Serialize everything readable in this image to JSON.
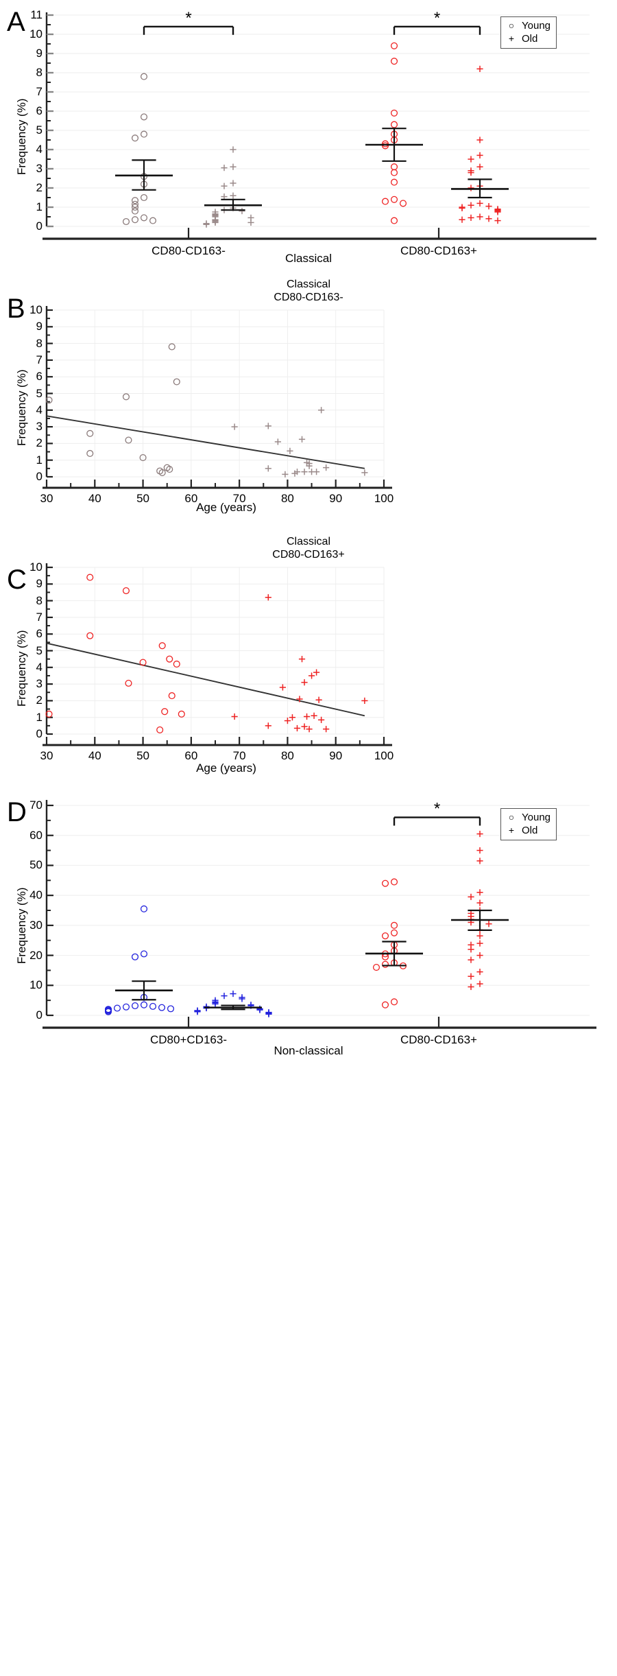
{
  "figure": {
    "panels": [
      "A",
      "B",
      "C",
      "D"
    ]
  },
  "legend": {
    "young_symbol": "○",
    "young_label": "Young",
    "old_symbol": "+",
    "old_label": "Old"
  },
  "significance_marker": "*",
  "colors": {
    "young_gray": "#8a7a7a",
    "old_gray": "#9a8a8a",
    "red": "#ee2222",
    "blue": "#2222dd",
    "axis": "#222222",
    "grid": "#eeeeee",
    "fit_line": "#333333"
  },
  "panelA": {
    "letter": "A",
    "ylabel": "Frequency (%)",
    "xlabel": "Classical",
    "ylim": [
      0,
      11
    ],
    "yticks": [
      0,
      1,
      2,
      3,
      4,
      5,
      6,
      7,
      8,
      9,
      10,
      11
    ],
    "groups": [
      "CD80-CD163-",
      "CD80-CD163+"
    ],
    "chart_data": {
      "type": "scatter",
      "title": "",
      "xlabel": "Classical",
      "ylabel": "Frequency (%)",
      "ylim": [
        0,
        11
      ],
      "yticks": [
        0,
        1,
        2,
        3,
        4,
        5,
        6,
        7,
        8,
        9,
        10,
        11
      ],
      "categories": [
        "CD80-CD163-",
        "CD80-CD163+"
      ],
      "series": [
        {
          "name": "Young",
          "group": "CD80-CD163-",
          "marker": "circle",
          "color": "#8a7a7a",
          "values": [
            7.8,
            5.7,
            4.8,
            4.6,
            2.6,
            2.2,
            1.5,
            1.35,
            1.15,
            1.0,
            0.8,
            0.45,
            0.35,
            0.3,
            0.25
          ],
          "mean": 2.65,
          "sem_upper": 3.45,
          "sem_lower": 1.9
        },
        {
          "name": "Old",
          "group": "CD80-CD163-",
          "marker": "plus",
          "color": "#9a8a8a",
          "values": [
            4.0,
            3.05,
            3.1,
            2.25,
            2.1,
            1.55,
            1.6,
            0.95,
            0.85,
            0.75,
            0.8,
            0.65,
            0.6,
            0.55,
            0.5,
            0.45,
            0.35,
            0.3,
            0.25,
            0.2,
            0.2,
            0.15,
            0.1
          ],
          "mean": 1.1,
          "sem_upper": 1.4,
          "sem_lower": 0.85
        },
        {
          "name": "Young",
          "group": "CD80-CD163+",
          "marker": "circle",
          "color": "#ee2222",
          "values": [
            9.4,
            8.6,
            5.9,
            5.3,
            4.8,
            4.5,
            4.3,
            4.2,
            3.1,
            2.8,
            2.3,
            1.4,
            1.3,
            1.2,
            0.3
          ],
          "mean": 4.25,
          "sem_upper": 5.1,
          "sem_lower": 3.4
        },
        {
          "name": "Old",
          "group": "CD80-CD163+",
          "marker": "plus",
          "color": "#ee2222",
          "values": [
            8.2,
            4.5,
            3.7,
            3.5,
            3.1,
            2.9,
            2.8,
            2.1,
            2.0,
            1.2,
            1.1,
            1.05,
            1.0,
            0.95,
            0.9,
            0.85,
            0.8,
            0.75,
            0.5,
            0.45,
            0.4,
            0.35,
            0.3
          ],
          "mean": 1.95,
          "sem_upper": 2.45,
          "sem_lower": 1.5
        }
      ],
      "annotations": [
        {
          "text": "*",
          "between": [
            "CD80-CD163- Young",
            "CD80-CD163- Old"
          ],
          "y": 10.4
        },
        {
          "text": "*",
          "between": [
            "CD80-CD163+ Young",
            "CD80-CD163+ Old"
          ],
          "y": 10.4
        }
      ]
    }
  },
  "panelB": {
    "letter": "B",
    "title": "Classical\nCD80-CD163-",
    "ylabel": "Frequency (%)",
    "xlabel": "Age (years)",
    "ylim": [
      0,
      10
    ],
    "xlim": [
      30,
      100
    ],
    "yticks": [
      0,
      1,
      2,
      3,
      4,
      5,
      6,
      7,
      8,
      9,
      10
    ],
    "xticks": [
      30,
      40,
      50,
      60,
      70,
      80,
      90,
      100
    ],
    "chart_data": {
      "type": "scatter",
      "title": "Classical CD80-CD163-",
      "xlabel": "Age (years)",
      "ylabel": "Frequency (%)",
      "xlim": [
        30,
        100
      ],
      "ylim": [
        0,
        10
      ],
      "xticks": [
        30,
        40,
        50,
        60,
        70,
        80,
        90,
        100
      ],
      "yticks": [
        0,
        1,
        2,
        3,
        4,
        5,
        6,
        7,
        8,
        9,
        10
      ],
      "series": [
        {
          "name": "Young",
          "marker": "circle",
          "color": "#8a7a7a",
          "points": [
            [
              30.5,
              4.6
            ],
            [
              39,
              2.6
            ],
            [
              39,
              1.4
            ],
            [
              46.5,
              4.8
            ],
            [
              47,
              2.2
            ],
            [
              50,
              1.15
            ],
            [
              53.5,
              0.35
            ],
            [
              54,
              0.25
            ],
            [
              55,
              0.55
            ],
            [
              55.5,
              0.45
            ],
            [
              56,
              7.8
            ],
            [
              57,
              5.7
            ]
          ]
        },
        {
          "name": "Old",
          "marker": "plus",
          "color": "#9a8a8a",
          "points": [
            [
              69,
              3.0
            ],
            [
              76,
              3.05
            ],
            [
              76,
              0.5
            ],
            [
              78,
              2.1
            ],
            [
              79.5,
              0.15
            ],
            [
              80.5,
              1.55
            ],
            [
              81.5,
              0.2
            ],
            [
              82,
              0.3
            ],
            [
              83,
              2.25
            ],
            [
              83.5,
              0.3
            ],
            [
              84,
              0.85
            ],
            [
              84.5,
              0.8
            ],
            [
              84.5,
              0.65
            ],
            [
              85,
              0.3
            ],
            [
              86,
              0.3
            ],
            [
              87,
              4.0
            ],
            [
              88,
              0.55
            ],
            [
              96,
              0.25
            ]
          ]
        }
      ],
      "fit_line": {
        "x": [
          30,
          96
        ],
        "y": [
          3.65,
          0.5
        ],
        "color": "#333333"
      }
    }
  },
  "panelC": {
    "letter": "C",
    "title": "Classical\nCD80-CD163+",
    "ylabel": "Frequency (%)",
    "xlabel": "Age (years)",
    "ylim": [
      0,
      10
    ],
    "xlim": [
      30,
      100
    ],
    "yticks": [
      0,
      1,
      2,
      3,
      4,
      5,
      6,
      7,
      8,
      9,
      10
    ],
    "xticks": [
      30,
      40,
      50,
      60,
      70,
      80,
      90,
      100
    ],
    "chart_data": {
      "type": "scatter",
      "title": "Classical CD80-CD163+",
      "xlabel": "Age (years)",
      "ylabel": "Frequency (%)",
      "xlim": [
        30,
        100
      ],
      "ylim": [
        0,
        10
      ],
      "xticks": [
        30,
        40,
        50,
        60,
        70,
        80,
        90,
        100
      ],
      "yticks": [
        0,
        1,
        2,
        3,
        4,
        5,
        6,
        7,
        8,
        9,
        10
      ],
      "series": [
        {
          "name": "Young",
          "marker": "circle",
          "color": "#ee2222",
          "points": [
            [
              30.5,
              1.2
            ],
            [
              39,
              9.4
            ],
            [
              39,
              5.9
            ],
            [
              46.5,
              8.6
            ],
            [
              47,
              3.05
            ],
            [
              50,
              4.3
            ],
            [
              53.5,
              0.25
            ],
            [
              54,
              5.3
            ],
            [
              54.5,
              1.35
            ],
            [
              55.5,
              4.5
            ],
            [
              56,
              2.3
            ],
            [
              57,
              4.2
            ],
            [
              58,
              1.2
            ]
          ]
        },
        {
          "name": "Old",
          "marker": "plus",
          "color": "#ee2222",
          "points": [
            [
              69,
              1.05
            ],
            [
              76,
              8.2
            ],
            [
              76,
              0.5
            ],
            [
              79,
              2.8
            ],
            [
              80,
              0.8
            ],
            [
              81,
              1.0
            ],
            [
              82,
              0.35
            ],
            [
              82.5,
              2.1
            ],
            [
              83,
              4.5
            ],
            [
              83.5,
              3.1
            ],
            [
              83.5,
              0.45
            ],
            [
              84,
              1.05
            ],
            [
              84.5,
              0.3
            ],
            [
              85,
              3.5
            ],
            [
              85.5,
              1.1
            ],
            [
              86,
              3.7
            ],
            [
              86.5,
              2.05
            ],
            [
              87,
              0.85
            ],
            [
              88,
              0.3
            ],
            [
              96,
              2.0
            ]
          ]
        }
      ],
      "fit_line": {
        "x": [
          30,
          96
        ],
        "y": [
          5.45,
          1.1
        ],
        "color": "#333333"
      }
    }
  },
  "panelD": {
    "letter": "D",
    "ylabel": "Frequency (%)",
    "xlabel": "Non-classical",
    "ylim": [
      0,
      70
    ],
    "yticks": [
      0,
      10,
      20,
      30,
      40,
      50,
      60,
      70
    ],
    "groups": [
      "CD80+CD163-",
      "CD80-CD163+"
    ],
    "chart_data": {
      "type": "scatter",
      "title": "",
      "xlabel": "Non-classical",
      "ylabel": "Frequency (%)",
      "ylim": [
        0,
        70
      ],
      "yticks": [
        0,
        10,
        20,
        30,
        40,
        50,
        60,
        70
      ],
      "categories": [
        "CD80+CD163-",
        "CD80-CD163+"
      ],
      "series": [
        {
          "name": "Young",
          "group": "CD80+CD163-",
          "marker": "circle",
          "color": "#2222dd",
          "values": [
            35.5,
            20.5,
            19.5,
            6.0,
            3.5,
            3.2,
            3.0,
            2.8,
            2.6,
            2.4,
            2.2,
            2.0,
            1.8,
            1.5,
            1.2
          ],
          "mean": 8.3,
          "sem_upper": 11.4,
          "sem_lower": 5.2
        },
        {
          "name": "Old",
          "group": "CD80+CD163-",
          "marker": "plus",
          "color": "#2222dd",
          "values": [
            7.2,
            6.5,
            6.0,
            5.5,
            5.0,
            4.5,
            4.2,
            3.8,
            3.5,
            3.2,
            2.9,
            2.6,
            2.4,
            2.2,
            2.0,
            1.8,
            1.6,
            1.4,
            1.2,
            1.0,
            0.8,
            0.6,
            0.4
          ],
          "mean": 2.6,
          "sem_upper": 3.3,
          "sem_lower": 2.0
        },
        {
          "name": "Young",
          "group": "CD80-CD163+",
          "marker": "circle",
          "color": "#ee2222",
          "values": [
            44.5,
            44.0,
            30.0,
            27.5,
            26.5,
            23.5,
            21.5,
            20.5,
            19.5,
            17.5,
            17.0,
            16.5,
            16.0,
            4.5,
            3.5
          ],
          "mean": 20.6,
          "sem_upper": 24.6,
          "sem_lower": 16.6
        },
        {
          "name": "Old",
          "group": "CD80-CD163+",
          "marker": "plus",
          "color": "#ee2222",
          "values": [
            60.5,
            55.0,
            51.5,
            41.0,
            39.5,
            37.5,
            35.0,
            34.0,
            33.0,
            32.0,
            31.0,
            30.5,
            28.5,
            26.5,
            24.0,
            23.5,
            22.0,
            20.0,
            18.5,
            14.5,
            13.0,
            10.5,
            9.5
          ],
          "mean": 31.8,
          "sem_upper": 35.0,
          "sem_lower": 28.4
        }
      ],
      "annotations": [
        {
          "text": "*",
          "between": [
            "CD80-CD163+ Young",
            "CD80-CD163+ Old"
          ],
          "y": 66
        }
      ]
    }
  }
}
